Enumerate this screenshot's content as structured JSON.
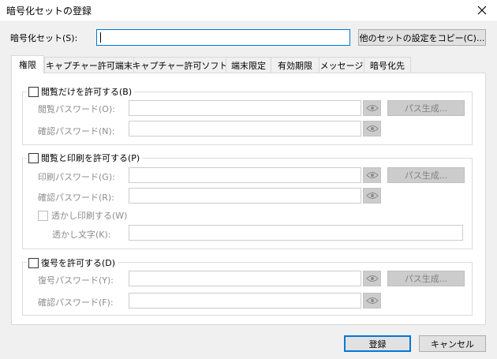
{
  "window": {
    "title": "暗号化セットの登録"
  },
  "set_name": {
    "label": "暗号化セット(S):",
    "value": "",
    "copy_button": "他のセットの設定をコピー(C)..."
  },
  "tabs": [
    {
      "label": "権限"
    },
    {
      "label": "キャプチャー許可端末"
    },
    {
      "label": "キャプチャー許可ソフト"
    },
    {
      "label": "端末限定"
    },
    {
      "label": "有効期限"
    },
    {
      "label": "メッセージ"
    },
    {
      "label": "暗号化先"
    }
  ],
  "group_view": {
    "checkbox_label": "閲覧だけを許可する(B)",
    "checked": false,
    "password_label": "閲覧パスワード(O):",
    "confirm_label": "確認パスワード(N):",
    "generate_button": "パス生成..."
  },
  "group_print": {
    "checkbox_label": "閲覧と印刷を許可する(P)",
    "checked": false,
    "password_label": "印刷パスワード(G):",
    "confirm_label": "確認パスワード(R):",
    "generate_button": "パス生成...",
    "watermark_checkbox_label": "透かし印刷する(W)",
    "watermark_checked": false,
    "watermark_text_label": "透かし文字(K):"
  },
  "group_decrypt": {
    "checkbox_label": "復号を許可する(D)",
    "checked": false,
    "password_label": "復号パスワード(Y):",
    "confirm_label": "確認パスワード(F):",
    "generate_button": "パス生成..."
  },
  "footer": {
    "register_button": "登録",
    "cancel_button": "キャンセル"
  },
  "colors": {
    "accent": "#0078d7",
    "disabled_text": "#8d8d8d",
    "disabled_fill": "#cccccc"
  }
}
